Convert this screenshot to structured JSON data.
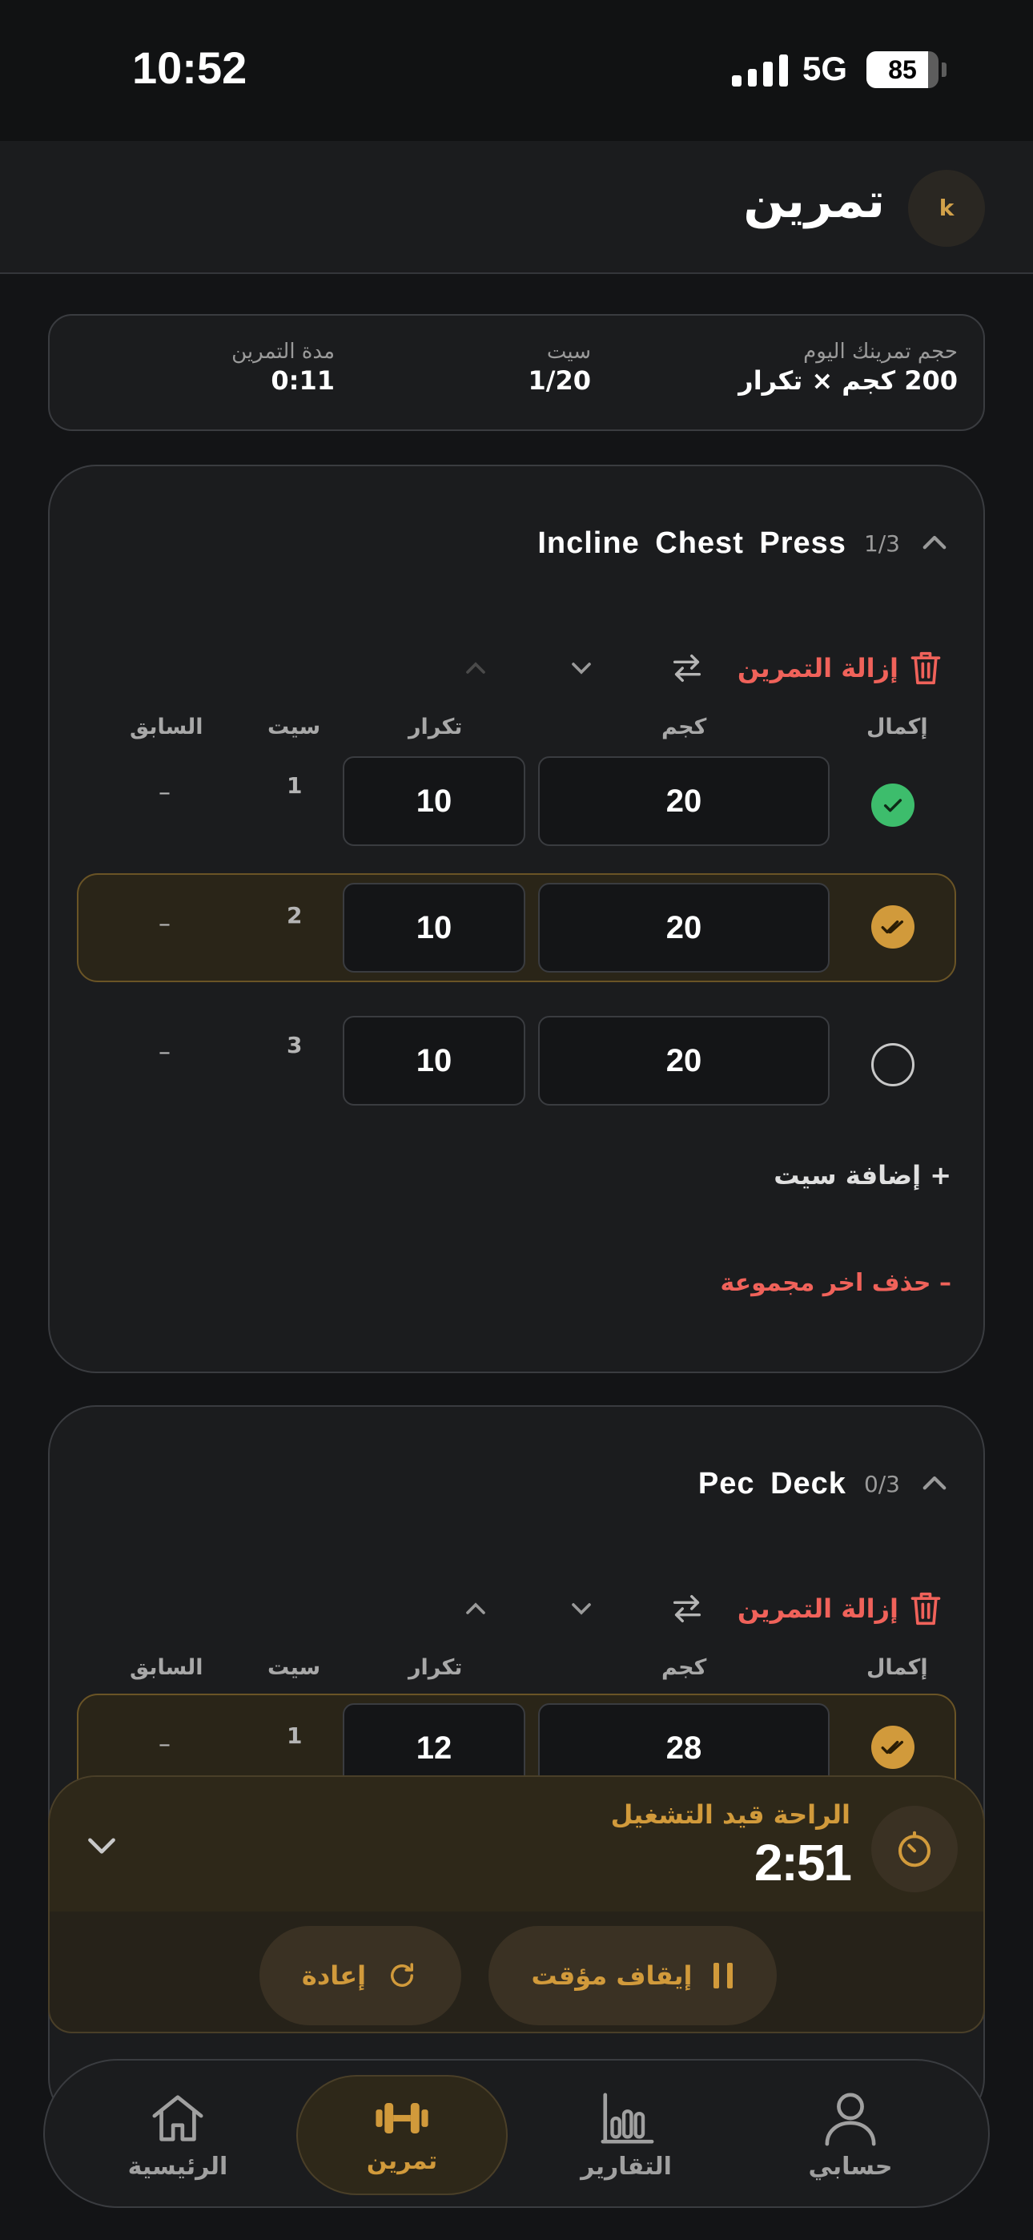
{
  "status": {
    "time": "10:52",
    "network": "5G",
    "battery": "85",
    "battery_level": 0.85
  },
  "header": {
    "title": "تمرين",
    "avatar_initial": "k"
  },
  "summary": {
    "volume_label": "حجم تمرينك اليوم",
    "volume_value": "200 كجم × تكرار",
    "sets_label": "سيت",
    "sets_value": "1/20",
    "duration_label": "مدة التمرين",
    "duration_value": "0:11"
  },
  "exercises": [
    {
      "name": "Incline Chest Press",
      "count": "1/3",
      "remove_label": "إزالة التمرين",
      "columns": {
        "complete": "إكمال",
        "weight": "كجم",
        "reps": "تكرار",
        "set": "سيت",
        "previous": "السابق"
      },
      "sets": [
        {
          "num": "1",
          "weight": "20",
          "reps": "10",
          "previous": "–",
          "state": "done"
        },
        {
          "num": "2",
          "weight": "20",
          "reps": "10",
          "previous": "–",
          "state": "active"
        },
        {
          "num": "3",
          "weight": "20",
          "reps": "10",
          "previous": "–",
          "state": "pending"
        }
      ],
      "add_set_label": "+ إضافة سيت",
      "delete_group_label": "– حذف اخر مجموعة"
    },
    {
      "name": "Pec Deck",
      "count": "0/3",
      "remove_label": "إزالة التمرين",
      "columns": {
        "complete": "إكمال",
        "weight": "كجم",
        "reps": "تكرار",
        "set": "سيت",
        "previous": "السابق"
      },
      "sets": [
        {
          "num": "1",
          "weight": "28",
          "reps": "12",
          "previous": "–",
          "state": "active"
        }
      ]
    }
  ],
  "rest_timer": {
    "label": "الراحة قيد التشغيل",
    "time": "2:51",
    "pause_label": "إيقاف مؤقت",
    "reset_label": "إعادة"
  },
  "nav": {
    "home": "الرئيسية",
    "workout": "تمرين",
    "reports": "التقارير",
    "account": "حسابي"
  },
  "colors": {
    "accent": "#d19a3b",
    "danger": "#f0625a",
    "success": "#3dbd6c",
    "background": "#131416"
  }
}
